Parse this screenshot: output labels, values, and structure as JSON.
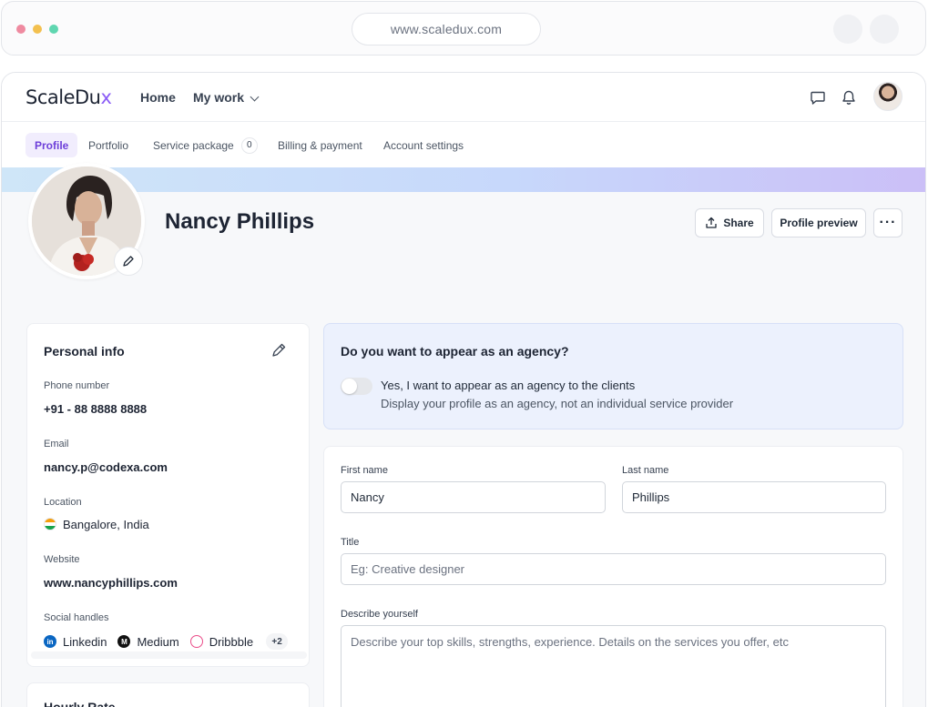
{
  "browser": {
    "url": "www.scaledux.com"
  },
  "app": {
    "logo": {
      "text": "ScaleDu",
      "accent": "x"
    },
    "nav": {
      "home": "Home",
      "my_work": "My work"
    },
    "tabs": [
      {
        "label": "Profile",
        "active": true
      },
      {
        "label": "Portfolio"
      },
      {
        "label": "Service package",
        "badge": "0"
      },
      {
        "label": "Billing & payment"
      },
      {
        "label": "Account settings"
      }
    ]
  },
  "profile": {
    "name": "Nancy Phillips",
    "actions": {
      "share": "Share",
      "preview": "Profile preview",
      "more": "···"
    }
  },
  "personal_info": {
    "title": "Personal info",
    "phone": {
      "label": "Phone number",
      "value": "+91 - 88 8888 8888"
    },
    "email": {
      "label": "Email",
      "value": "nancy.p@codexa.com"
    },
    "location": {
      "label": "Location",
      "value": "Bangalore, India"
    },
    "website": {
      "label": "Website",
      "value": "www.nancyphillips.com"
    },
    "social": {
      "label": "Social handles",
      "items": [
        "Linkedin",
        "Medium",
        "Dribbble"
      ],
      "more": "+2"
    }
  },
  "hourly_rate": {
    "title": "Hourly Rate"
  },
  "agency": {
    "question": "Do you want to appear as an agency?",
    "toggle_on": false,
    "option_label": "Yes, I want to appear as an agency to the clients",
    "option_desc": "Display your profile as an agency, not an individual service provider"
  },
  "form": {
    "first_name": {
      "label": "First name",
      "value": "Nancy"
    },
    "last_name": {
      "label": "Last name",
      "value": "Phillips"
    },
    "title": {
      "label": "Title",
      "placeholder": "Eg: Creative designer"
    },
    "describe": {
      "label": "Describe yourself",
      "placeholder": "Describe your top skills, strengths, experience. Details on the services you offer, etc"
    }
  },
  "colors": {
    "accent": "#6d3fd9",
    "banner_start": "#cfe6f8",
    "banner_end": "#cbbff7",
    "agency_bg": "#ecf1fd"
  },
  "icons": [
    "chat-icon",
    "bell-icon",
    "pencil-icon",
    "share-icon",
    "india-flag-icon",
    "linkedin-icon",
    "medium-icon",
    "dribbble-icon"
  ]
}
